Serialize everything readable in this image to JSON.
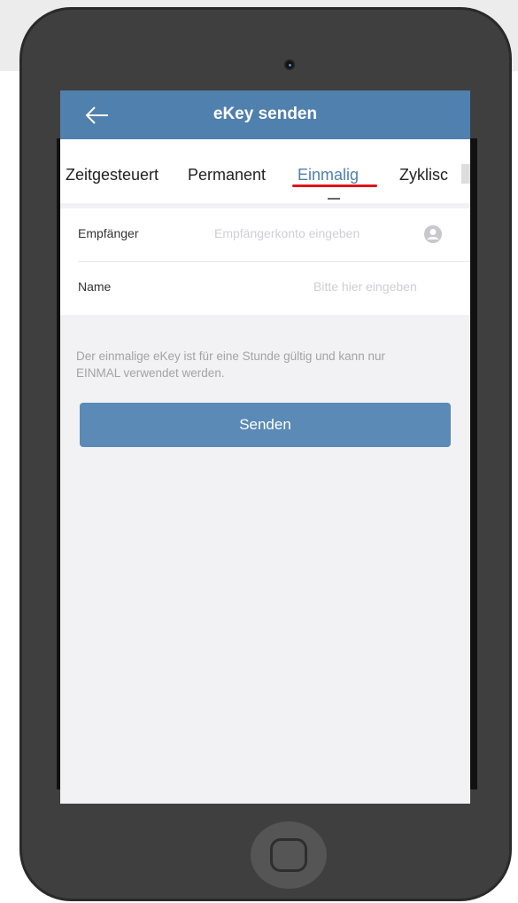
{
  "nav": {
    "title": "eKey senden",
    "back_icon": "arrow-left-icon"
  },
  "tabs": [
    {
      "label": "Zeitgesteuert",
      "active": false
    },
    {
      "label": "Permanent",
      "active": false
    },
    {
      "label": "Einmalig",
      "active": true
    },
    {
      "label": "Zyklisc",
      "active": false
    }
  ],
  "form": {
    "recipient": {
      "label": "Empfänger",
      "placeholder": "Empfängerkonto eingeben",
      "icon": "contact-icon"
    },
    "name": {
      "label": "Name",
      "placeholder": "Bitte hier eingeben"
    }
  },
  "hint": "Der einmalige eKey ist für eine Stunde gültig und kann nur EINMAL verwendet werden.",
  "send_button": "Senden",
  "colors": {
    "primary": "#5080ad",
    "button": "#5a8ab5",
    "active_underline": "#e0101c",
    "phone_body": "#3f3f3f"
  }
}
